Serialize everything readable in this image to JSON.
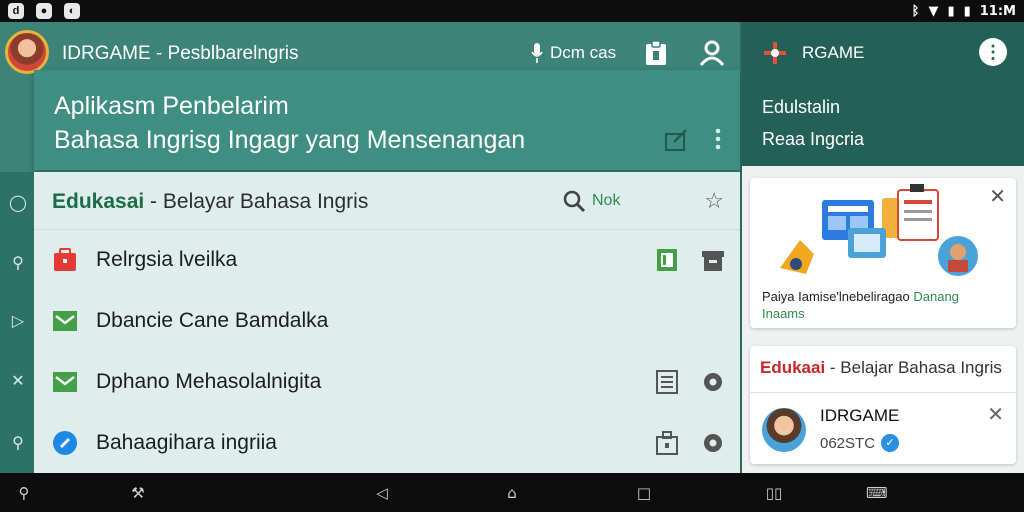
{
  "status_bar": {
    "left_icons": [
      "notification-icon-a",
      "notification-icon-b",
      "notification-icon-c"
    ],
    "time": "11:M"
  },
  "header": {
    "app_title": "IDRGAME - Pesblbarelngris",
    "action_text": "Dcm cas",
    "card_line1": "Aplikasm Penbelarim",
    "card_line2": "Bahasa Ingrisg Ingagr yang Mensenangan"
  },
  "list": {
    "header_brand": "Edukasai",
    "header_rest": " - Belayar Bahasa Ingris",
    "search_label": "Nok",
    "rows": [
      {
        "label": "Relrgsia lveilka",
        "icon": "red-bag-icon",
        "color": "#e53935"
      },
      {
        "label": "Dbancie Cane Bamdalka",
        "icon": "green-mail-icon",
        "color": "#43a047"
      },
      {
        "label": "Dphano Mehasolalnigita",
        "icon": "green-mail-icon",
        "color": "#43a047"
      },
      {
        "label": "Bahaagihara ingriia",
        "icon": "blue-pin-icon",
        "color": "#1e88e5"
      }
    ]
  },
  "right_panel": {
    "app_name": "RGAME",
    "line1": "Edulstalin",
    "line2": "Reaa Ingcria",
    "promo_text_part1": "Paiya Iamise'lnebeliragao ",
    "promo_text_highlight": "Danang",
    "promo_text_part2": "Inaams",
    "notif_brand": "Edukaai",
    "notif_rest": " - Belajar Bahasa Ingris",
    "notif_name": "IDRGAME",
    "notif_code": "062STC"
  },
  "colors": {
    "accent_teal": "#3d8377",
    "dark_teal": "#236055",
    "brand_green": "#1e6b4a",
    "alert_red": "#c62828"
  }
}
